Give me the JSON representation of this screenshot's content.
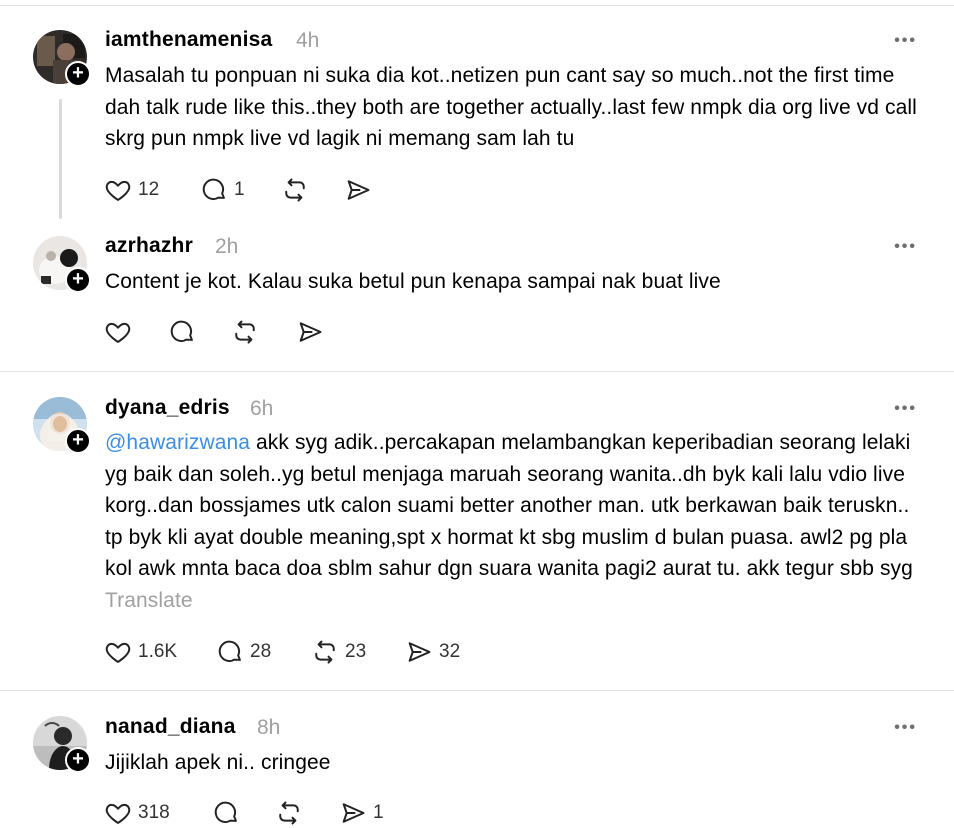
{
  "posts": [
    {
      "username": "iamthenamenisa",
      "time": "4h",
      "text": "Masalah tu ponpuan ni suka dia kot..netizen pun cant say so much..not the first time dah talk rude like this..they both are together actually..last few nmpk dia org live vd call skrg pun nmpk live vd lagik ni memang sam lah tu",
      "likes": "12",
      "replies": "1",
      "reposts": "",
      "shares": ""
    },
    {
      "username": "azrhazhr",
      "time": "2h",
      "text": "Content je kot. Kalau suka betul pun kenapa sampai nak buat live",
      "likes": "",
      "replies": "",
      "reposts": "",
      "shares": ""
    },
    {
      "username": "dyana_edris",
      "time": "6h",
      "mention": "@hawarizwana",
      "text": "akk syg adik..percakapan melambangkan keperibadian seorang lelaki yg baik dan soleh..yg betul menjaga maruah seorang wanita..dh byk kali lalu vdio live korg..dan bossjames utk calon suami better another man. utk berkawan baik teruskn.. tp byk kli ayat double meaning,spt x hormat kt sbg muslim d bulan puasa. awl2 pg pla kol awk mnta baca doa sblm sahur dgn suara wanita pagi2 aurat tu. akk tegur sbb syg",
      "translate": "Translate",
      "likes": "1.6K",
      "replies": "28",
      "reposts": "23",
      "shares": "32"
    },
    {
      "username": "nanad_diana",
      "time": "8h",
      "text": "Jijiklah apek ni.. cringee",
      "likes": "318",
      "replies": "",
      "reposts": "",
      "shares": "1"
    }
  ],
  "ui": {
    "more": "•••",
    "follow": "+"
  },
  "icons": {
    "like": "heart-icon",
    "reply": "comment-icon",
    "repost": "repost-icon",
    "share": "share-icon",
    "more": "more-icon"
  }
}
